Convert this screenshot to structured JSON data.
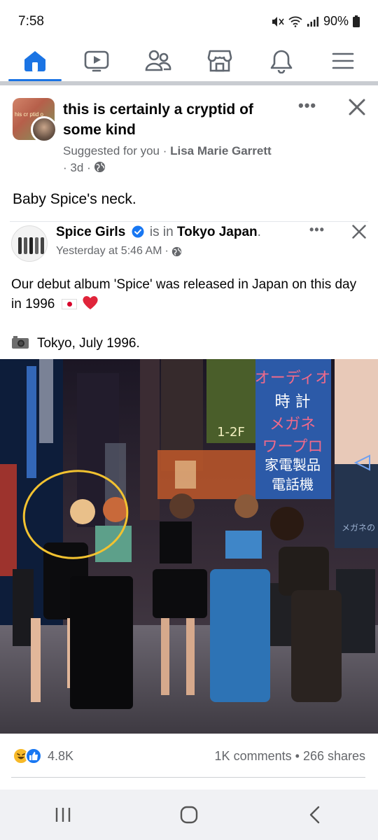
{
  "status_bar": {
    "time": "7:58",
    "battery": "90%"
  },
  "nav": {
    "items": [
      {
        "name": "home",
        "icon": "home-icon",
        "active": true
      },
      {
        "name": "watch",
        "icon": "video-icon"
      },
      {
        "name": "friends",
        "icon": "friends-icon"
      },
      {
        "name": "marketplace",
        "icon": "marketplace-icon"
      },
      {
        "name": "notifications",
        "icon": "bell-icon"
      },
      {
        "name": "menu",
        "icon": "menu-icon"
      }
    ],
    "accent_color": "#1b74e4"
  },
  "post": {
    "group_title": "this is certainly a cryptid of some kind",
    "suggested_label": "Suggested for you",
    "separator": "·",
    "author": "Lisa Marie Garrett",
    "age": "3d",
    "text": "Baby Spice's neck.",
    "avatar_text": "his cr ptid o"
  },
  "shared_post": {
    "page_name": "Spice Girls",
    "is_in": "is in",
    "location": "Tokyo Japan",
    "location_suffix": ".",
    "timestamp": "Yesterday at 5:46 AM",
    "separator": "·",
    "body_line1": "Our debut album 'Spice' was released in Japan on this day in 1996",
    "body_line2": "Tokyo, July 1996."
  },
  "photo_signs": {
    "sign1": "オーディオ",
    "sign2": "時 計",
    "sign3": "メガネ",
    "sign4": "ワープロ",
    "sign5": "家電製品",
    "sign6": "電話機",
    "sign7": "1-2F",
    "sign8": "メガネの"
  },
  "footer": {
    "reaction_count": "4.8K",
    "comments": "1K comments",
    "dot": "•",
    "shares": "266 shares"
  }
}
